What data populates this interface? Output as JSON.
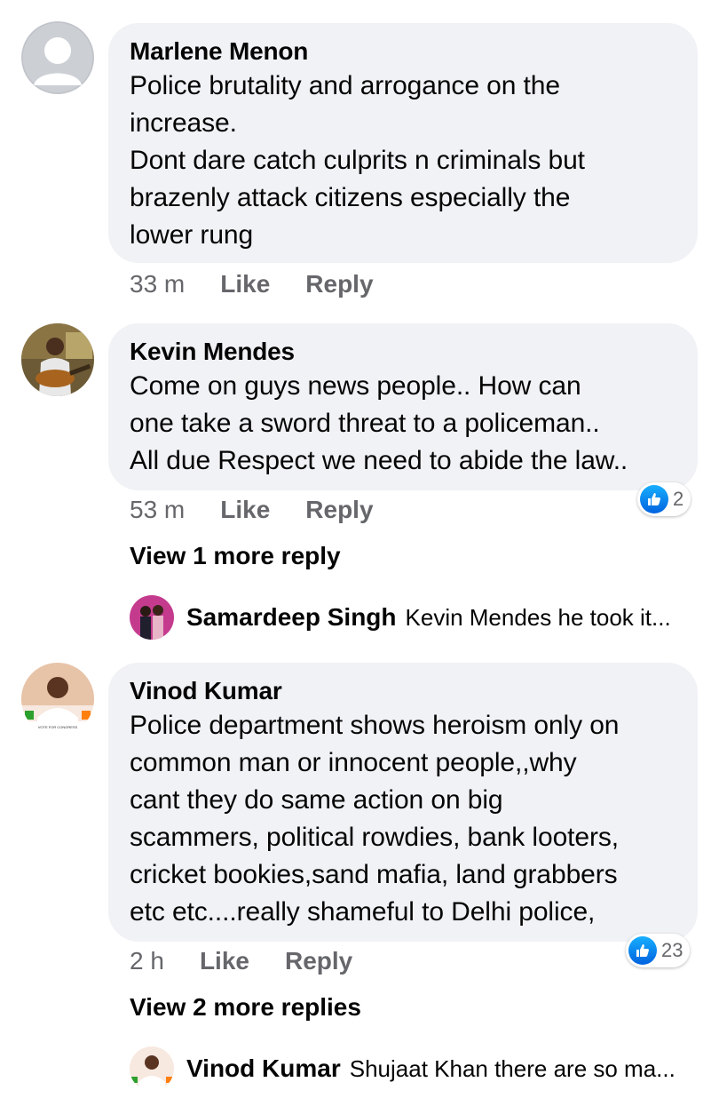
{
  "comments": [
    {
      "author": "Marlene Menon",
      "text": "Police brutality and arrogance on the\nincrease.\nDont dare catch culprits n criminals but\nbrazenly attack citizens especially the\nlower rung",
      "time": "33 m",
      "like_label": "Like",
      "reply_label": "Reply",
      "avatar_icon": "default-profile-icon"
    },
    {
      "author": "Kevin Mendes",
      "text": "Come on guys news people.. How can\none take a sword threat to a policeman..\nAll due Respect we need to abide the law..",
      "time": "53 m",
      "like_label": "Like",
      "reply_label": "Reply",
      "reaction_count": "2",
      "view_more": "View 1 more reply",
      "reply_preview": {
        "author": "Samardeep Singh",
        "text": "Kevin Mendes he took it..."
      }
    },
    {
      "author": "Vinod Kumar",
      "text": "Police department shows heroism only on\ncommon man or innocent people,,why\ncant they do same action on big\nscammers, political rowdies, bank looters,\ncricket bookies,sand mafia, land grabbers\netc etc....really shameful to Delhi police,",
      "time": "2 h",
      "like_label": "Like",
      "reply_label": "Reply",
      "reaction_count": "23",
      "view_more": "View 2 more replies",
      "reply_preview": {
        "author": "Vinod Kumar",
        "text": "Shujaat Khan there are so ma..."
      }
    }
  ],
  "colors": {
    "bubble": "#f0f2f5",
    "meta_text": "#65676b",
    "like_blue": "#1877f2"
  }
}
